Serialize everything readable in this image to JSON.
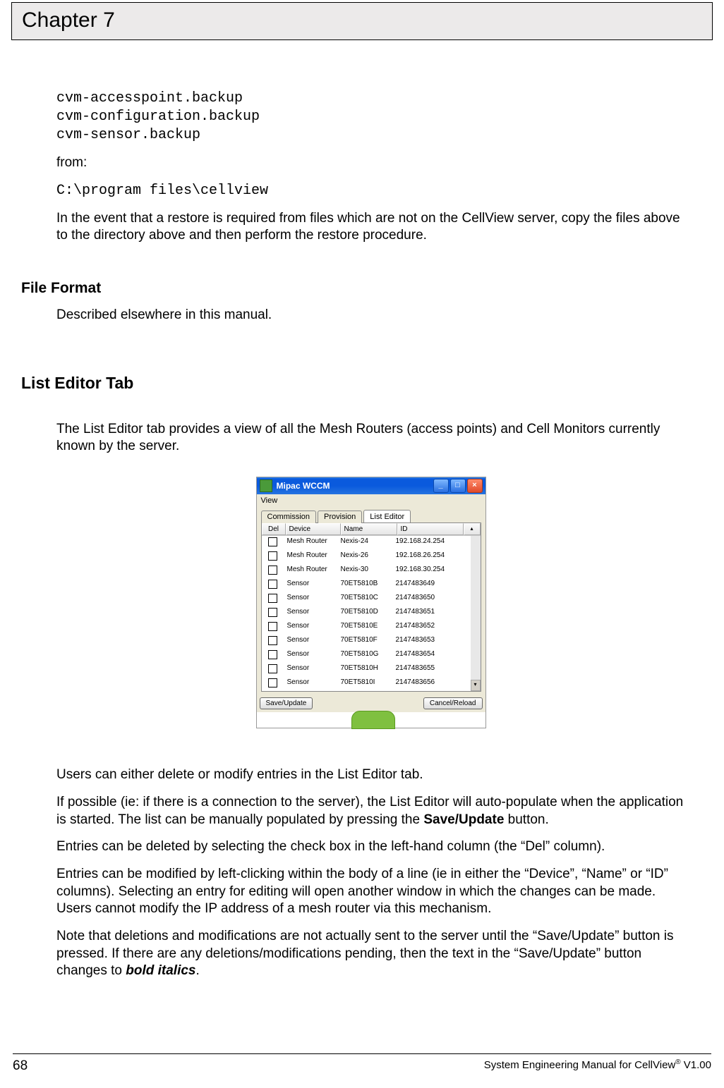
{
  "chapter": "Chapter 7",
  "code_block1_line1": "cvm-accesspoint.backup",
  "code_block1_line2": "cvm-configuration.backup",
  "code_block1_line3": "cvm-sensor.backup",
  "from_label": "from:",
  "code_block2": "C:\\program files\\cellview",
  "paragraph_restore": "In the event that a restore is required from files which are not on the CellView server, copy the files above to the directory above and then perform the restore procedure.",
  "heading_file_format": "File Format",
  "paragraph_file_format": "Described elsewhere in this manual.",
  "heading_list_editor": "List Editor Tab",
  "paragraph_list_editor_intro": "The List Editor tab provides a view of all the Mesh Routers (access points) and Cell Monitors currently known by the server.",
  "paragraph_users_can": "Users can either delete or modify entries in the List Editor tab.",
  "paragraph_if_possible_a": "If possible (ie: if there is a connection to the server), the List Editor will auto-populate when the application is started.  The list can be manually populated by pressing the ",
  "save_update_bold": "Save/Update",
  "paragraph_if_possible_b": " button.",
  "paragraph_deleted": "Entries can be deleted by selecting the check box in the left-hand column (the “Del” column).",
  "paragraph_modified": "Entries can be modified by left-clicking within the body of a line (ie in either the “Device”, “Name” or “ID” columns).  Selecting an entry for editing will open another window in which the changes can be made.  Users cannot modify the IP address of a mesh router via this mechanism.",
  "paragraph_note_a": "Note that deletions and modifications are not actually sent to the server until the “Save/Update” button is pressed.  If there are any deletions/modifications pending, then the text in the “Save/Update” button changes to ",
  "bold_italics": "bold italics",
  "paragraph_note_b": ".",
  "footer_page": "68",
  "footer_right_a": "System Engineering Manual for CellView",
  "footer_right_sup": "®",
  "footer_right_b": " V1.00",
  "window": {
    "title": "Mipac WCCM",
    "menu_view": "View",
    "tabs": {
      "commission": "Commission",
      "provision": "Provision",
      "list_editor": "List Editor"
    },
    "headers": {
      "del": "Del",
      "device": "Device",
      "name": "Name",
      "id": "ID"
    },
    "rows": [
      {
        "device": "Mesh Router",
        "name": "Nexis-24",
        "id": "192.168.24.254"
      },
      {
        "device": "Mesh Router",
        "name": "Nexis-26",
        "id": "192.168.26.254"
      },
      {
        "device": "Mesh Router",
        "name": "Nexis-30",
        "id": "192.168.30.254"
      },
      {
        "device": "Sensor",
        "name": "70ET5810B",
        "id": "2147483649"
      },
      {
        "device": "Sensor",
        "name": "70ET5810C",
        "id": "2147483650"
      },
      {
        "device": "Sensor",
        "name": "70ET5810D",
        "id": "2147483651"
      },
      {
        "device": "Sensor",
        "name": "70ET5810E",
        "id": "2147483652"
      },
      {
        "device": "Sensor",
        "name": "70ET5810F",
        "id": "2147483653"
      },
      {
        "device": "Sensor",
        "name": "70ET5810G",
        "id": "2147483654"
      },
      {
        "device": "Sensor",
        "name": "70ET5810H",
        "id": "2147483655"
      },
      {
        "device": "Sensor",
        "name": "70ET5810I",
        "id": "2147483656"
      }
    ],
    "btn_save": "Save/Update",
    "btn_cancel": "Cancel/Reload"
  }
}
